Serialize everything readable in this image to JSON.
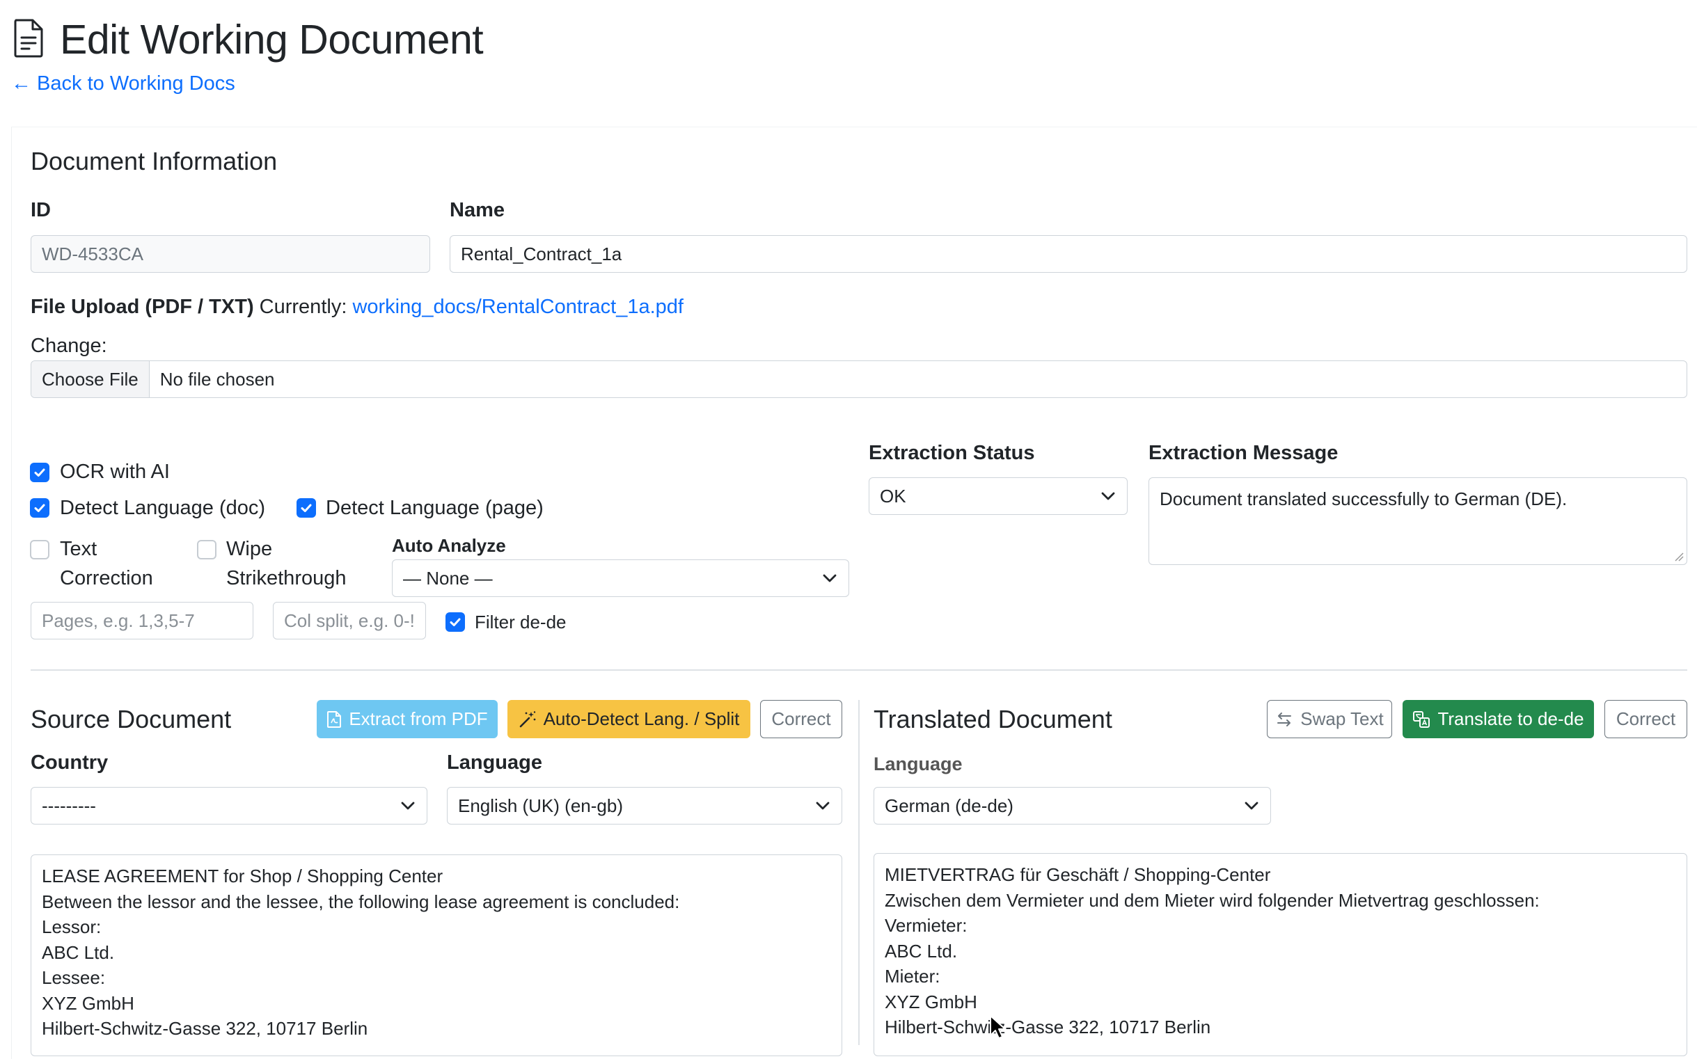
{
  "header": {
    "title": "Edit Working Document",
    "back_link": "← Back to Working Docs"
  },
  "doc_info": {
    "section_title": "Document Information",
    "id_label": "ID",
    "id_value": "WD-4533CA",
    "name_label": "Name",
    "name_value": "Rental_Contract_1a",
    "upload_label": "File Upload (PDF / TXT)",
    "currently_label": "Currently:",
    "current_file": "working_docs/RentalContract_1a.pdf",
    "change_label": "Change:",
    "choose_file": "Choose File",
    "no_file": "No file chosen"
  },
  "options": {
    "ocr_ai": {
      "label": "OCR with AI",
      "checked": true
    },
    "detect_lang_doc": {
      "label": "Detect Language (doc)",
      "checked": true
    },
    "detect_lang_page": {
      "label": "Detect Language (page)",
      "checked": true
    },
    "text_correction": {
      "label_line1": "Text",
      "label_line2": "Correction",
      "checked": false
    },
    "wipe_strike": {
      "label_line1": "Wipe",
      "label_line2": "Strikethrough",
      "checked": false
    },
    "auto_analyze_label": "Auto Analyze",
    "auto_analyze_value": "— None —",
    "pages_placeholder": "Pages, e.g. 1,3,5-7",
    "col_split_placeholder": "Col split, e.g. 0-!",
    "filter": {
      "label": "Filter de-de",
      "checked": true
    }
  },
  "extraction": {
    "status_label": "Extraction Status",
    "status_value": "OK",
    "message_label": "Extraction Message",
    "message_value": "Document translated successfully to German (DE)."
  },
  "source": {
    "title": "Source Document",
    "extract_btn": "Extract from PDF",
    "autodetect_btn": "Auto-Detect Lang. / Split",
    "correct_btn": "Correct",
    "country_label": "Country",
    "country_value": "---------",
    "language_label": "Language",
    "language_value": "English (UK) (en-gb)",
    "lines": [
      "LEASE AGREEMENT for Shop / Shopping Center",
      "Between the lessor and the lessee, the following lease agreement is concluded:",
      "Lessor:",
      "ABC Ltd.",
      "Lessee:",
      "XYZ GmbH",
      "Hilbert-Schwitz-Gasse 322, 10717 Berlin"
    ]
  },
  "translated": {
    "title": "Translated Document",
    "swap_btn": "Swap Text",
    "translate_btn": "Translate to de-de",
    "correct_btn": "Correct",
    "language_label": "Language",
    "language_value": "German (de-de)",
    "lines": [
      "MIETVERTRAG für Geschäft / Shopping-Center",
      "Zwischen dem Vermieter und dem Mieter wird folgender Mietvertrag geschlossen:",
      "Vermieter:",
      "ABC Ltd.",
      "Mieter:",
      "XYZ GmbH",
      "Hilbert-Schwitz-Gasse 322, 10717 Berlin"
    ]
  },
  "colors": {
    "primary": "#0d6efd",
    "info": "#6ec7f2",
    "warning": "#f7c343",
    "success": "#238a4d"
  }
}
